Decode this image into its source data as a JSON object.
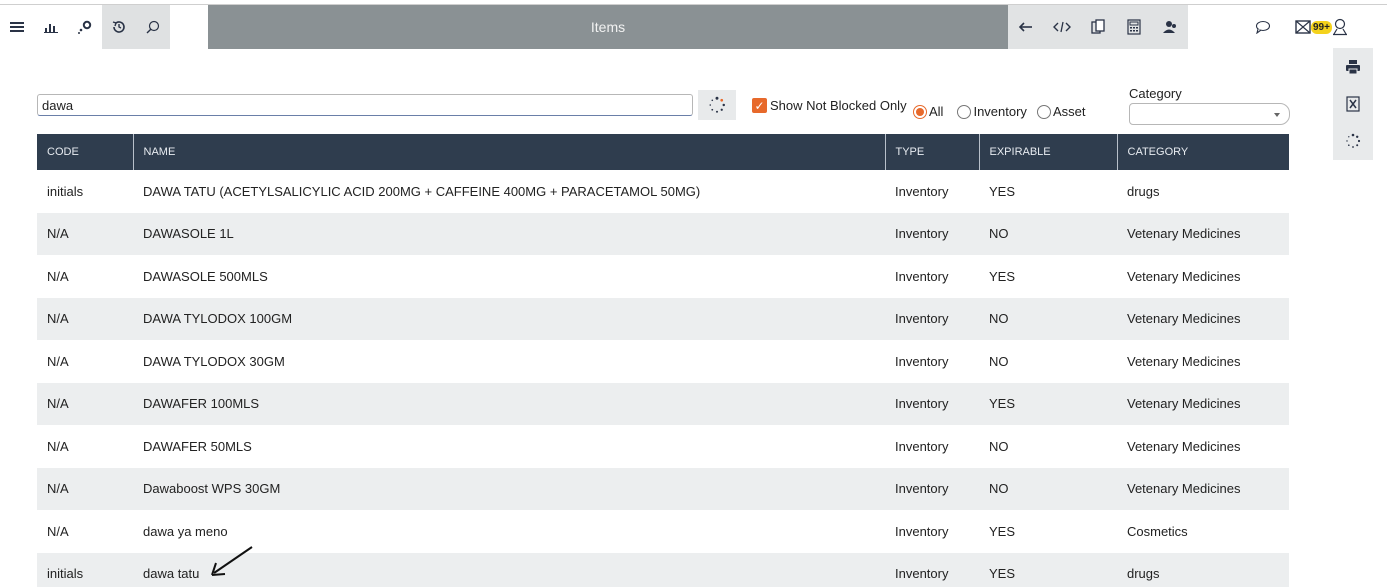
{
  "header": {
    "title": "Items",
    "badge_count": "99+"
  },
  "search": {
    "value": "dawa",
    "show_not_blocked_label": "Show Not Blocked Only",
    "radio_all": "All",
    "radio_inventory": "Inventory",
    "radio_asset": "Asset",
    "category_label": "Category",
    "category_value": ""
  },
  "table": {
    "headers": [
      "CODE",
      "NAME",
      "TYPE",
      "EXPIRABLE",
      "CATEGORY"
    ],
    "rows": [
      [
        "initials",
        "DAWA TATU (ACETYLSALICYLIC ACID 200MG + CAFFEINE 400MG + PARACETAMOL 50MG)",
        "Inventory",
        "YES",
        "drugs"
      ],
      [
        "N/A",
        "DAWASOLE 1L",
        "Inventory",
        "NO",
        "Vetenary Medicines"
      ],
      [
        "N/A",
        "DAWASOLE 500MLS",
        "Inventory",
        "YES",
        "Vetenary Medicines"
      ],
      [
        "N/A",
        "DAWA TYLODOX 100GM",
        "Inventory",
        "NO",
        "Vetenary Medicines"
      ],
      [
        "N/A",
        "DAWA TYLODOX 30GM",
        "Inventory",
        "NO",
        "Vetenary Medicines"
      ],
      [
        "N/A",
        "DAWAFER 100MLS",
        "Inventory",
        "YES",
        "Vetenary Medicines"
      ],
      [
        "N/A",
        "DAWAFER 50MLS",
        "Inventory",
        "NO",
        "Vetenary Medicines"
      ],
      [
        "N/A",
        "Dawaboost WPS 30GM",
        "Inventory",
        "NO",
        "Vetenary Medicines"
      ],
      [
        "N/A",
        "dawa ya meno",
        "Inventory",
        "YES",
        "Cosmetics"
      ],
      [
        "initials",
        "dawa tatu",
        "Inventory",
        "YES",
        "drugs"
      ]
    ]
  },
  "icons": {
    "toolbar_left": [
      "menu-icon",
      "bar-chart-icon",
      "dots-icon",
      "history-icon",
      "search-icon"
    ],
    "toolbar_right": [
      "back-arrow-icon",
      "code-icon",
      "copy-icon",
      "calculator-icon",
      "users-icon"
    ],
    "toolbar_far": [
      "chat-icon",
      "mail-icon",
      "user-icon"
    ],
    "side": [
      "print-icon",
      "excel-icon",
      "spinner-icon"
    ]
  },
  "colors": {
    "accent": "#e7692b",
    "header_bg": "#2f3d4e",
    "title_bar": "#8a9194",
    "badge": "#f4d21c"
  }
}
